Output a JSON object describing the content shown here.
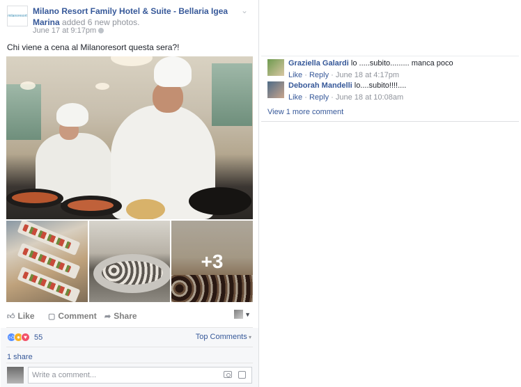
{
  "post": {
    "page_name": "Milano Resort Family Hotel & Suite - Bellaria Igea Marina",
    "activity": "added 6 new photos.",
    "logo_text": "milanoresort",
    "timestamp": "June 17 at 9:17pm",
    "text": "Chi viene a cena al Milanoresort questa sera?!",
    "more_photos_label": "+3"
  },
  "actions": {
    "like": "Like",
    "comment": "Comment",
    "share": "Share"
  },
  "reactions": {
    "count": "55",
    "top_comments": "Top Comments"
  },
  "shares": "1 share",
  "composer": {
    "placeholder": "Write a comment..."
  },
  "comments": [
    {
      "name": "Graziella Galardi",
      "text": "lo .....subito......... manca poco",
      "like": "Like",
      "reply": "Reply",
      "time": "June 18 at 4:17pm"
    },
    {
      "name": "Deborah Mandelli",
      "text": "lo....subito!!!!....",
      "like": "Like",
      "reply": "Reply",
      "time": "June 18 at 10:08am"
    }
  ],
  "view_more": "View 1 more comment",
  "colors": {
    "link": "#365899",
    "meta": "#90949c",
    "like_reaction": "#5890ff",
    "love_reaction": "#f25268",
    "wow_reaction": "#f7b125"
  },
  "icons": [
    "chevron-down-icon",
    "globe-icon",
    "like-icon",
    "comment-icon",
    "share-icon",
    "camera-icon",
    "sticker-icon"
  ]
}
